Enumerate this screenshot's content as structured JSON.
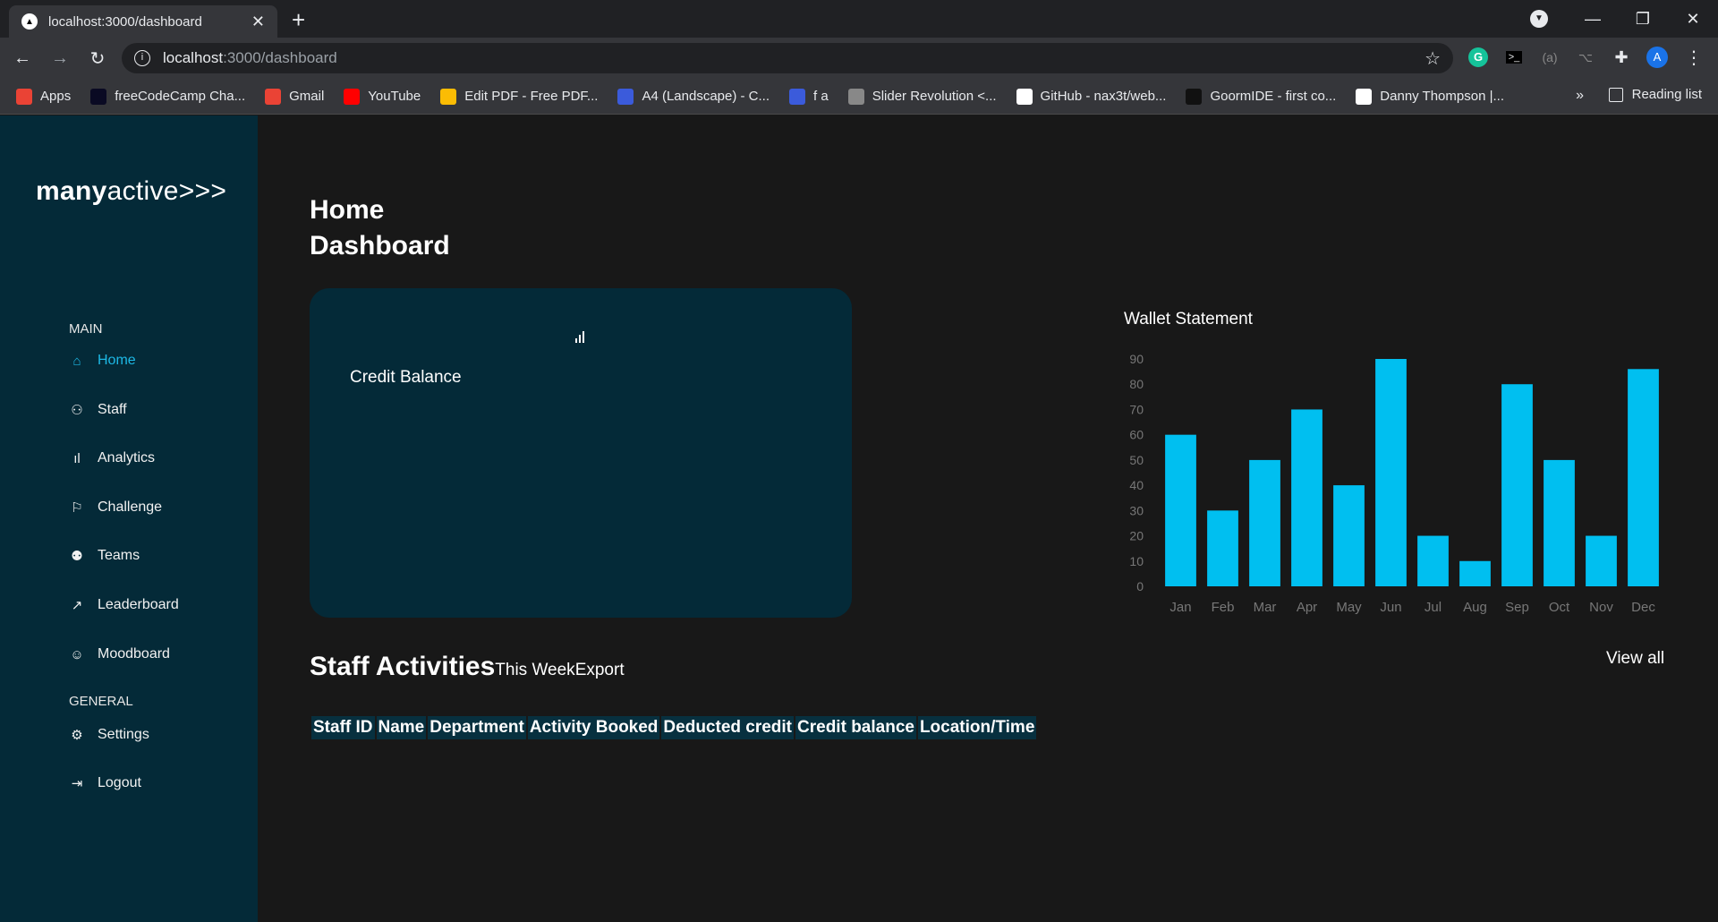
{
  "browser": {
    "tab_title": "localhost:3000/dashboard",
    "url_host": "localhost",
    "url_path": ":3000/dashboard",
    "bookmarks": [
      {
        "label": "Apps",
        "icon": "apps-grid-icon",
        "color": "#ea4335"
      },
      {
        "label": "freeCodeCamp Cha...",
        "icon": "freecodecamp-icon",
        "color": "#0a0a23"
      },
      {
        "label": "Gmail",
        "icon": "gmail-icon",
        "color": "#ea4335"
      },
      {
        "label": "YouTube",
        "icon": "youtube-icon",
        "color": "#ff0000"
      },
      {
        "label": "Edit PDF - Free PDF...",
        "icon": "pdf-icon",
        "color": "#fbbc04"
      },
      {
        "label": "A4 (Landscape) - C...",
        "icon": "canva-icon",
        "color": "#3b5bdb"
      },
      {
        "label": "f a",
        "icon": "canva-icon",
        "color": "#3b5bdb"
      },
      {
        "label": "Slider Revolution <...",
        "icon": "slider-icon",
        "color": "#888888"
      },
      {
        "label": "GitHub - nax3t/web...",
        "icon": "github-icon",
        "color": "#ffffff"
      },
      {
        "label": "GoormIDE - first co...",
        "icon": "terminal-icon",
        "color": "#111111"
      },
      {
        "label": "Danny Thompson |...",
        "icon": "globe-icon",
        "color": "#ffffff"
      }
    ],
    "more": "»",
    "reading_list": "Reading list",
    "profile_initial": "A"
  },
  "app": {
    "logo_bold": "many",
    "logo_light": "active>>>",
    "sections": {
      "main": "MAIN",
      "general": "GENERAL"
    },
    "nav": [
      {
        "label": "Home",
        "icon": "home-icon",
        "glyph": "⌂"
      },
      {
        "label": "Staff",
        "icon": "user-icon",
        "glyph": "⚇"
      },
      {
        "label": "Analytics",
        "icon": "bar-chart-icon",
        "glyph": "ıl"
      },
      {
        "label": "Challenge",
        "icon": "flag-icon",
        "glyph": "⚐"
      },
      {
        "label": "Teams",
        "icon": "users-icon",
        "glyph": "⚉"
      },
      {
        "label": "Leaderboard",
        "icon": "trending-up-icon",
        "glyph": "↗"
      }
    ],
    "nav_moodboard": {
      "label": "Moodboard",
      "icon": "smile-icon",
      "glyph": "☺"
    },
    "nav_general": [
      {
        "label": "Settings",
        "icon": "gear-icon",
        "glyph": "⚙"
      },
      {
        "label": "Logout",
        "icon": "logout-icon",
        "glyph": "⇥"
      }
    ],
    "title_line1": "Home",
    "title_line2": "Dashboard",
    "card_label": "Credit Balance",
    "chart_title": "Wallet Statement",
    "activities_title": "Staff Activities",
    "activities_period": "This Week",
    "activities_export": "Export",
    "view_all": "View all",
    "table_headers": [
      "Staff ID",
      "Name",
      "Department",
      "Activity Booked",
      "Deducted credit",
      "Credit balance",
      "Location/Time"
    ],
    "colors": {
      "sidebar": "#042a38",
      "accent": "#1db8e5",
      "bar": "#00bff0",
      "background": "#181818"
    }
  },
  "chart_data": {
    "type": "bar",
    "title": "Wallet Statement",
    "categories": [
      "Jan",
      "Feb",
      "Mar",
      "Apr",
      "May",
      "Jun",
      "Jul",
      "Aug",
      "Sep",
      "Oct",
      "Nov",
      "Dec"
    ],
    "values": [
      60,
      30,
      50,
      70,
      40,
      90,
      20,
      10,
      80,
      50,
      20,
      86
    ],
    "yticks": [
      0,
      10,
      20,
      30,
      40,
      50,
      60,
      70,
      80,
      90
    ],
    "ylim": [
      0,
      90
    ],
    "grid": false,
    "legend": "none"
  }
}
